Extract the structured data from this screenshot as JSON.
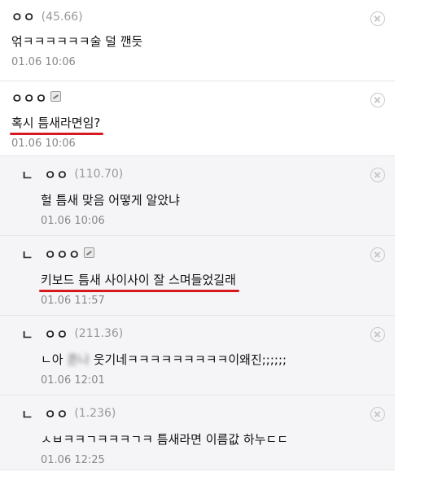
{
  "comments": [
    {
      "nick": "ㅇㅇ",
      "ip": "(45.66)",
      "text": "얶ㅋㅋㅋㅋㅋㅋ술 덜 깬듯",
      "time": "01.06 10:06"
    },
    {
      "nick": "ㅇㅇㅇ",
      "text": "혹시 틈새라면임?",
      "time": "01.06 10:06"
    },
    {
      "nick": "ㅇㅇ",
      "ip": "(110.70)",
      "text": "헐 틈새 맞음 어떻게 알았냐",
      "time": "01.06 10:06"
    },
    {
      "nick": "ㅇㅇㅇ",
      "text": "키보드 틈새 사이사이 잘 스며들었길래",
      "time": "01.06 11:57"
    },
    {
      "nick": "ㅇㅇ",
      "ip": "(211.36)",
      "text_pre": "ㄴ아 ",
      "text_blur": "흔나",
      "text_post": " 웃기네ㅋㅋㅋㅋㅋㅋㅋㅋㅋ이왜진;;;;;;",
      "time": "01.06 12:01"
    },
    {
      "nick": "ㅇㅇ",
      "ip": "(1.236)",
      "text": "ㅅㅂㅋㅋㄱㅋㅋㅋㄱㅋ 틈새라면 이름값 하누ㄷㄷ",
      "time": "01.06 12:25"
    }
  ],
  "reply_mark": "ㄴ",
  "underline_color": "#d7191f"
}
